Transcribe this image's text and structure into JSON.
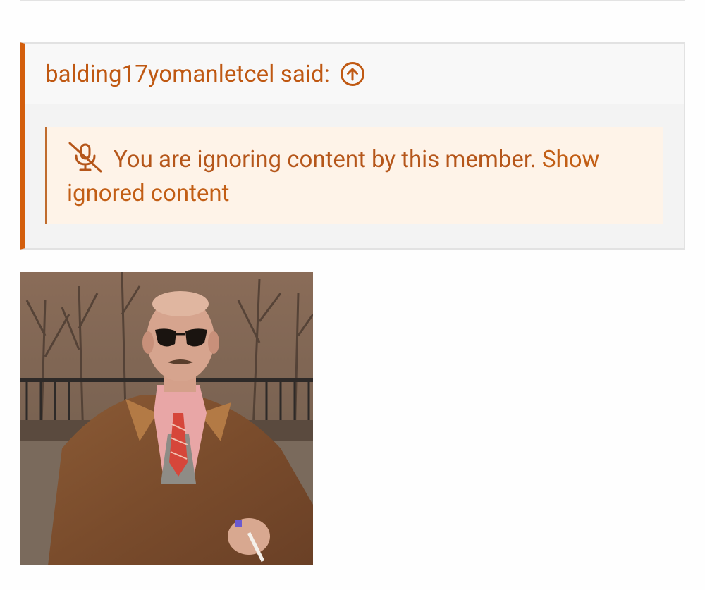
{
  "quote": {
    "author_line": "balding17yomanletcel said:",
    "ignored_message": "You are ignoring content by this member.",
    "show_link": "Show ignored content"
  },
  "icons": {
    "expand": "arrow-up-circle-icon",
    "ignored": "microphone-off-icon"
  },
  "colors": {
    "accent": "#d35e0c",
    "link": "#bf5812",
    "notice_bg": "#fef3e8",
    "quote_bg": "#f3f3f3"
  }
}
